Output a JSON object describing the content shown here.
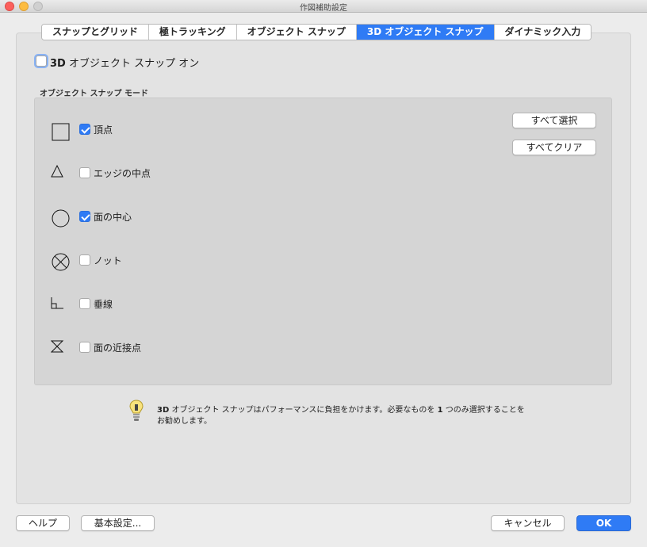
{
  "window": {
    "title": "作図補助設定"
  },
  "tabs": [
    {
      "label": "スナップとグリッド",
      "active": false
    },
    {
      "label": "極トラッキング",
      "active": false
    },
    {
      "label": "オブジェクト スナップ",
      "active": false
    },
    {
      "label": "3D オブジェクト スナップ",
      "active": true
    },
    {
      "label": "ダイナミック入力",
      "active": false
    }
  ],
  "main_toggle": {
    "label_bold": "3D",
    "label_rest": " オブジェクト スナップ オン",
    "checked": false
  },
  "group": {
    "title": "オブジェクト スナップ モード"
  },
  "snap_modes": [
    {
      "label": "頂点",
      "checked": true,
      "icon": "square-icon"
    },
    {
      "label": "エッジの中点",
      "checked": false,
      "icon": "triangle-icon"
    },
    {
      "label": "面の中心",
      "checked": true,
      "icon": "circle-icon"
    },
    {
      "label": "ノット",
      "checked": false,
      "icon": "knot-icon"
    },
    {
      "label": "垂線",
      "checked": false,
      "icon": "perpendicular-icon"
    },
    {
      "label": "面の近接点",
      "checked": false,
      "icon": "hourglass-icon"
    }
  ],
  "side_buttons": {
    "select_all": "すべて選択",
    "clear_all": "すべてクリア"
  },
  "hint": {
    "bold_prefix": "3D",
    "text_1": " オブジェクト スナップはパフォーマンスに負担をかけます。必要なものを ",
    "bold_mid": "1",
    "text_2": " つのみ選択することをお勧めします。"
  },
  "footer": {
    "help": "ヘルプ",
    "basic_settings": "基本設定...",
    "cancel": "キャンセル",
    "ok": "OK"
  },
  "colors": {
    "accent": "#2f7bf5"
  }
}
